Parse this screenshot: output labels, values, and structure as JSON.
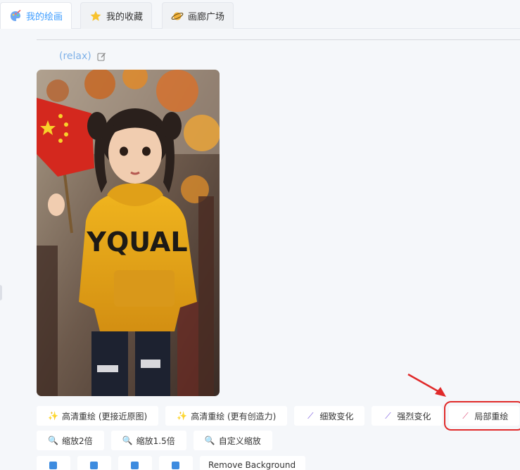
{
  "tabs": [
    {
      "label": "我的绘画",
      "icon": "palette-icon",
      "active": true
    },
    {
      "label": "我的收藏",
      "icon": "star-icon",
      "active": false
    },
    {
      "label": "画廊广场",
      "icon": "planet-icon",
      "active": false
    }
  ],
  "prompt": {
    "text": "(relax)",
    "edit_icon": "edit-icon"
  },
  "image": {
    "alt": "girl-with-flag-yellow-hoodie",
    "hoodie_text": "YQUAL"
  },
  "actions_row1": [
    {
      "label": "高清重绘 (更接近原图)",
      "icon": "sparkle-icon"
    },
    {
      "label": "高清重绘 (更有创造力)",
      "icon": "sparkle-icon"
    },
    {
      "label": "细致变化",
      "icon": "magic-wand-icon"
    },
    {
      "label": "强烈变化",
      "icon": "magic-wand-icon"
    },
    {
      "label": "局部重绘",
      "icon": "brush-icon",
      "highlighted": true
    }
  ],
  "actions_row2": [
    {
      "label": "缩放2倍",
      "icon": "magnifier-icon"
    },
    {
      "label": "缩放1.5倍",
      "icon": "magnifier-icon"
    },
    {
      "label": "自定义缩放",
      "icon": "magnifier-icon"
    }
  ],
  "actions_row3_partial": "Remove Background",
  "colors": {
    "accent": "#409eff",
    "highlight": "#e02a2a"
  }
}
